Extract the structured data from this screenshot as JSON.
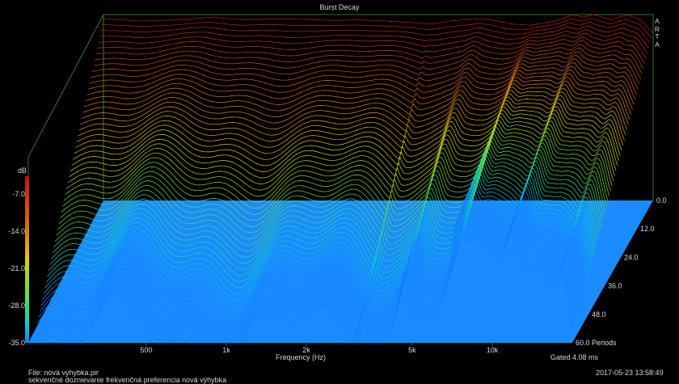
{
  "chart_data": {
    "type": "waterfall-3d",
    "title": "Burst Decay",
    "brand": "ARTA",
    "x_axis": {
      "label": "Frequency (Hz)",
      "scale": "log",
      "range_hz": [
        180,
        20000
      ],
      "ticks": [
        {
          "value": 500,
          "label": "500"
        },
        {
          "value": 1000,
          "label": "1k"
        },
        {
          "value": 2000,
          "label": "2k"
        },
        {
          "value": 5000,
          "label": "5k"
        },
        {
          "value": 10000,
          "label": "10k"
        }
      ]
    },
    "y_axis": {
      "label": "dB",
      "range": [
        -35,
        0
      ],
      "ticks": [
        {
          "value": -7,
          "label": "-7.0"
        },
        {
          "value": -14,
          "label": "-14.0"
        },
        {
          "value": -21,
          "label": "-21.0"
        },
        {
          "value": -28,
          "label": "-28.0"
        },
        {
          "value": -35,
          "label": "-35.0"
        }
      ]
    },
    "z_axis": {
      "label": "Periods",
      "range": [
        0,
        60
      ],
      "ticks": [
        {
          "value": 0,
          "label": "0.0"
        },
        {
          "value": 12,
          "label": "12.0"
        },
        {
          "value": 24,
          "label": "24.0"
        },
        {
          "value": 36,
          "label": "36.0"
        },
        {
          "value": 48,
          "label": "48.0"
        },
        {
          "value": 60,
          "label": "60.0 Periods"
        }
      ]
    },
    "initial_response": {
      "x_hz": [
        180,
        250,
        350,
        450,
        600,
        800,
        1000,
        1300,
        1600,
        2000,
        2500,
        3000,
        3500,
        4000,
        4500,
        5000,
        6000,
        7000,
        8000,
        9000,
        10000,
        11000,
        12000,
        14000,
        16000,
        18000,
        20000
      ],
      "y_db": [
        -0.8,
        -1.2,
        -1.0,
        -0.5,
        -1.0,
        -0.8,
        -0.9,
        -1.1,
        -1.0,
        -1.2,
        -1.5,
        -1.8,
        -1.2,
        -1.0,
        -0.8,
        -1.0,
        -1.8,
        -2.0,
        -1.5,
        -1.0,
        0.0,
        -0.5,
        0.0,
        -1.0,
        0.0,
        -1.0,
        -3.5
      ]
    },
    "slice_count": 60,
    "colorbar": [
      "#c01010",
      "#e07000",
      "#e0d000",
      "#80e000",
      "#00d8c8",
      "#1080ff"
    ],
    "floor_color": "#1a8cff",
    "footer": {
      "gated": "Gated 4.08 ms",
      "datetime": "2017-05-23  13:58:49",
      "file": "File: nová výhybka.pir",
      "description": "sekvenčné doznievanie frekvenčná preferencia nová výhybka"
    }
  }
}
